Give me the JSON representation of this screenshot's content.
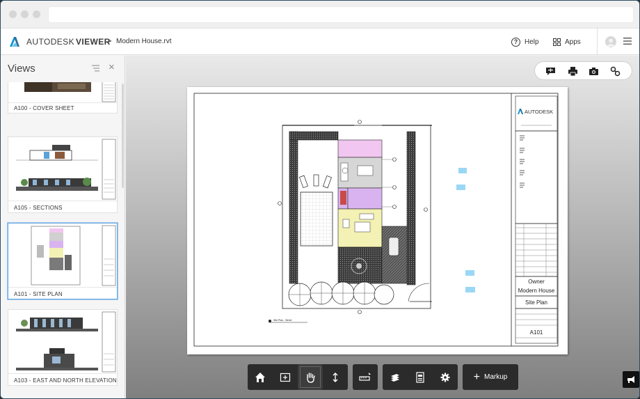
{
  "app": {
    "brand": "AUTODESK",
    "brand_suffix": "VIEWER",
    "breadcrumb_sep": ">",
    "file_name": "Modern House.rvt",
    "help_label": "Help",
    "apps_label": "Apps"
  },
  "sidebar": {
    "title": "Views",
    "items": [
      {
        "label": "A100 - COVER SHEET"
      },
      {
        "label": "A105 - SECTIONS"
      },
      {
        "label": "A101 - SITE PLAN",
        "active": true
      },
      {
        "label": "A103 - EAST AND NORTH ELEVATION"
      }
    ]
  },
  "sheet": {
    "company": "AUTODESK",
    "owner": "Owner",
    "project": "Modern House",
    "view_name": "Site Plan",
    "sheet_number": "A101",
    "plan_caption": "Site Plan - Street"
  },
  "markup": {
    "label": "Markup"
  },
  "colors": {
    "accent": "#0696d7",
    "toolbar_bg": "#2b2b2b",
    "room_pink": "#f1c6f0",
    "room_yellow": "#f3f1b3",
    "room_purple": "#d9b3f0",
    "water": "#9ad7f5"
  },
  "icons": [
    "home-icon",
    "fit-view-icon",
    "pan-icon",
    "zoom-icon",
    "measure-icon",
    "layers-icon",
    "properties-icon",
    "settings-icon",
    "comment-icon",
    "print-icon",
    "camera-icon",
    "link-icon",
    "feedback-icon",
    "filter-icon",
    "close-icon",
    "hamburger-icon"
  ]
}
